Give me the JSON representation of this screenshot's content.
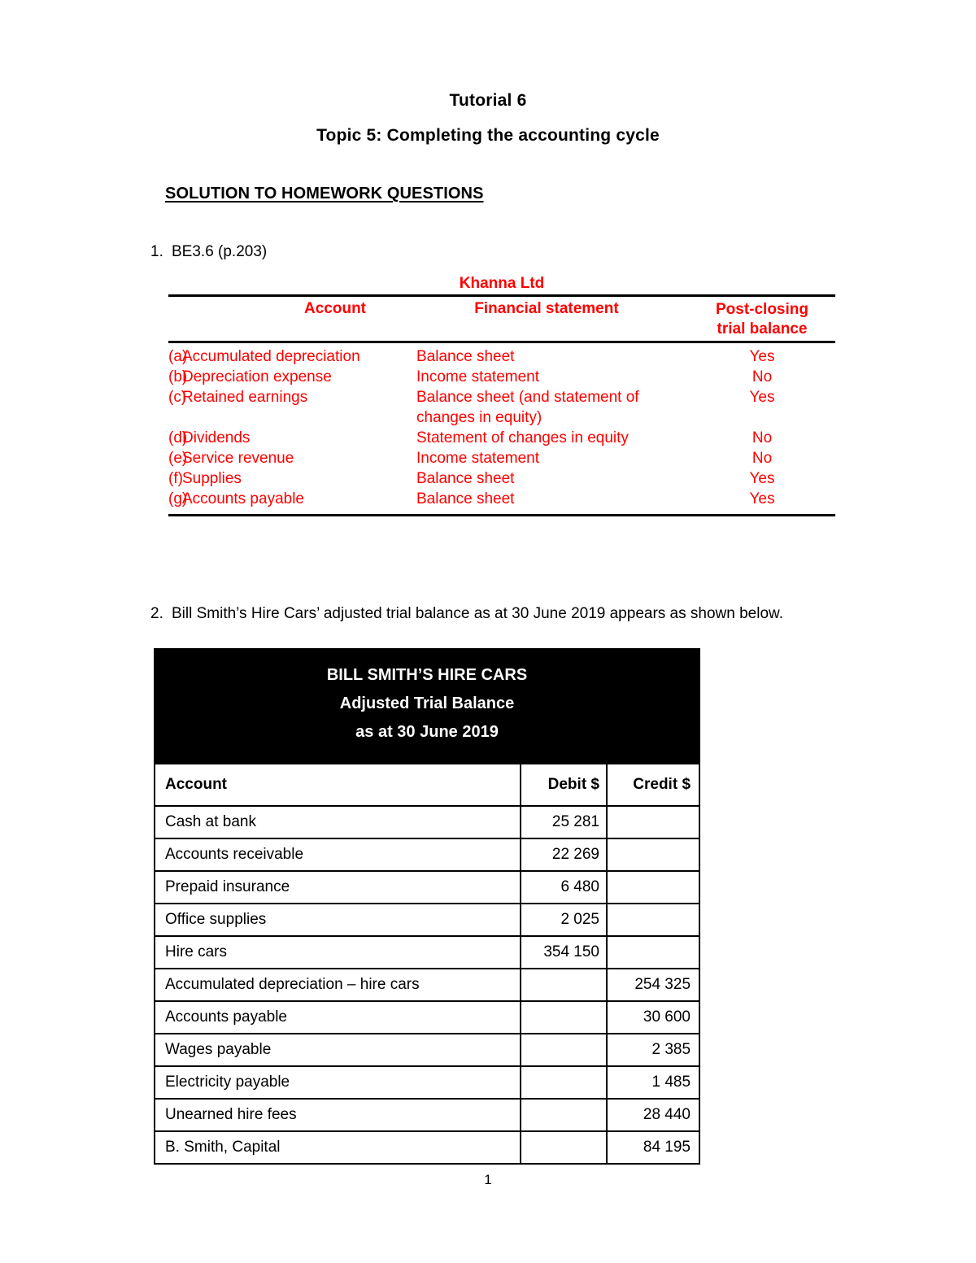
{
  "document": {
    "title": "Tutorial 6",
    "subtitle": "Topic 5: Completing the accounting cycle",
    "section_heading": "SOLUTION TO HOMEWORK QUESTIONS",
    "page_number": "1"
  },
  "question1": {
    "number": "1.",
    "text": "BE3.6 (p.203)",
    "table": {
      "caption": "Khanna Ltd",
      "headers": {
        "label": "",
        "account": "Account",
        "financial_statement": "Financial statement",
        "post_closing_line1": "Post-closing",
        "post_closing_line2": "trial balance"
      },
      "rows": [
        {
          "label": "(a)",
          "account": "Accumulated depreciation",
          "financial_statement": "Balance sheet",
          "financial_statement_cont": "",
          "post_closing": "Yes"
        },
        {
          "label": "(b)",
          "account": "Depreciation expense",
          "financial_statement": "Income statement",
          "financial_statement_cont": "",
          "post_closing": "No"
        },
        {
          "label": "(c)",
          "account": "Retained earnings",
          "financial_statement": "Balance sheet (and statement of",
          "financial_statement_cont": "changes in equity)",
          "post_closing": "Yes"
        },
        {
          "label": "(d)",
          "account": "Dividends",
          "financial_statement": "Statement of changes in equity",
          "financial_statement_cont": "",
          "post_closing": "No"
        },
        {
          "label": "(e)",
          "account": "Service revenue",
          "financial_statement": "Income statement",
          "financial_statement_cont": "",
          "post_closing": "No"
        },
        {
          "label": "(f)",
          "account": "Supplies",
          "financial_statement": "Balance sheet",
          "financial_statement_cont": "",
          "post_closing": "Yes"
        },
        {
          "label": "(g)",
          "account": "Accounts payable",
          "financial_statement": "Balance sheet",
          "financial_statement_cont": "",
          "post_closing": "Yes"
        }
      ],
      "text_color": "#FF0000"
    }
  },
  "question2": {
    "number": "2.",
    "text": "Bill Smith’s Hire Cars’ adjusted trial balance as at 30 June 2019 appears as shown below.",
    "table": {
      "title_line1": "BILL SMITH’S HIRE CARS",
      "title_line2": "Adjusted Trial Balance",
      "title_line3": "as at 30 June 2019",
      "title_background": "#000000",
      "title_color": "#FFFFFF",
      "headers": {
        "account": "Account",
        "debit": "Debit $",
        "credit": "Credit $"
      },
      "rows": [
        {
          "account": "Cash at bank",
          "debit": "25 281",
          "credit": ""
        },
        {
          "account": "Accounts receivable",
          "debit": "22 269",
          "credit": ""
        },
        {
          "account": "Prepaid insurance",
          "debit": "6 480",
          "credit": ""
        },
        {
          "account": "Office supplies",
          "debit": "2 025",
          "credit": ""
        },
        {
          "account": "Hire cars",
          "debit": "354 150",
          "credit": ""
        },
        {
          "account": "Accumulated depreciation – hire cars",
          "debit": "",
          "credit": "254 325"
        },
        {
          "account": "Accounts payable",
          "debit": "",
          "credit": "30 600"
        },
        {
          "account": "Wages payable",
          "debit": "",
          "credit": "2 385"
        },
        {
          "account": "Electricity payable",
          "debit": "",
          "credit": "1 485"
        },
        {
          "account": "Unearned hire fees",
          "debit": "",
          "credit": "28 440"
        },
        {
          "account": "B. Smith, Capital",
          "debit": "",
          "credit": "84 195"
        }
      ]
    }
  }
}
